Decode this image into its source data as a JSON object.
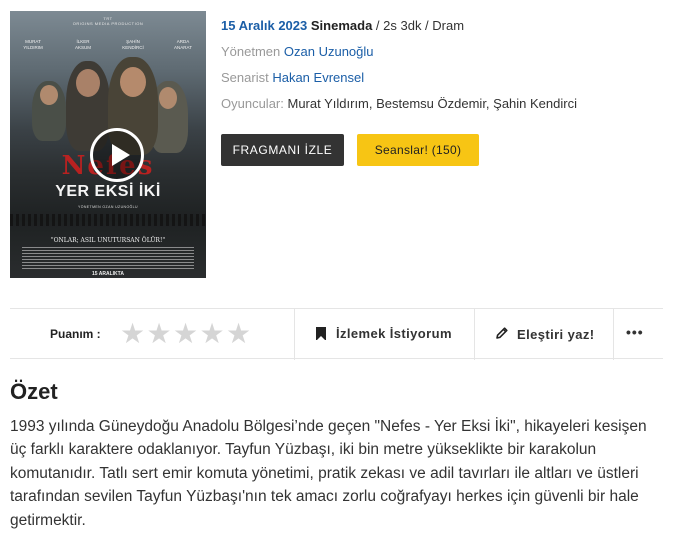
{
  "poster": {
    "studio": "TRT\nORIGINS MEDIA PRODUCTION",
    "cast_names": [
      "MURAT\nYILDIRIM",
      "İLKER\nAKSUM",
      "ŞAHİN\nKENDİRCİ",
      "ARDA\nANARAT"
    ],
    "title": "Nefes",
    "subtitle": "YER EKSİ İKİ",
    "director_line": "YÖNETMEN OZAN UZUNOĞLU",
    "tagline": "\"ONLAR; ASIL UNUTURSAN ÖLÜR!\"",
    "release": "15 ARALIKTA"
  },
  "movie": {
    "date": "15 Aralık 2023",
    "venue": "Sinemada",
    "meta": " / 2s 3dk / Dram",
    "director_label": "Yönetmen",
    "director": "Ozan Uzunoğlu",
    "writer_label": "Senarist",
    "writer": "Hakan Evrensel",
    "cast_label": "Oyuncular:",
    "cast": "Murat Yıldırım, Bestemsu Özdemir, Şahin Kendirci"
  },
  "buttons": {
    "trailer": "FRAGMANI İZLE",
    "sessions": "Seanslar! (150)"
  },
  "actions": {
    "rating_label": "Puanım :",
    "stars_filled": 0,
    "stars_total": 5,
    "watchlist": "İzlemek İstiyorum",
    "review": "Eleştiri yaz!",
    "more": "•••"
  },
  "summary": {
    "title": "Özet",
    "text": "1993 yılında Güneydoğu Anadolu Bölgesi’nde geçen \"Nefes - Yer Eksi İki\", hikayeleri kesişen üç farklı karaktere odaklanıyor. Tayfun Yüzbaşı, iki bin metre yükseklikte bir karakolun komutanıdır. Tatlı sert emir komuta yönetimi, pratik zekası ve adil tavırları ile altları ve üstleri tarafından sevilen Tayfun Yüzbaşı'nın tek amacı zorlu coğrafyayı herkes için güvenli bir hale getirmektir."
  },
  "colors": {
    "accent_blue": "#1b5ea7",
    "button_dark": "#333333",
    "button_yellow": "#f7c514",
    "star_empty": "#d5d5d5"
  }
}
